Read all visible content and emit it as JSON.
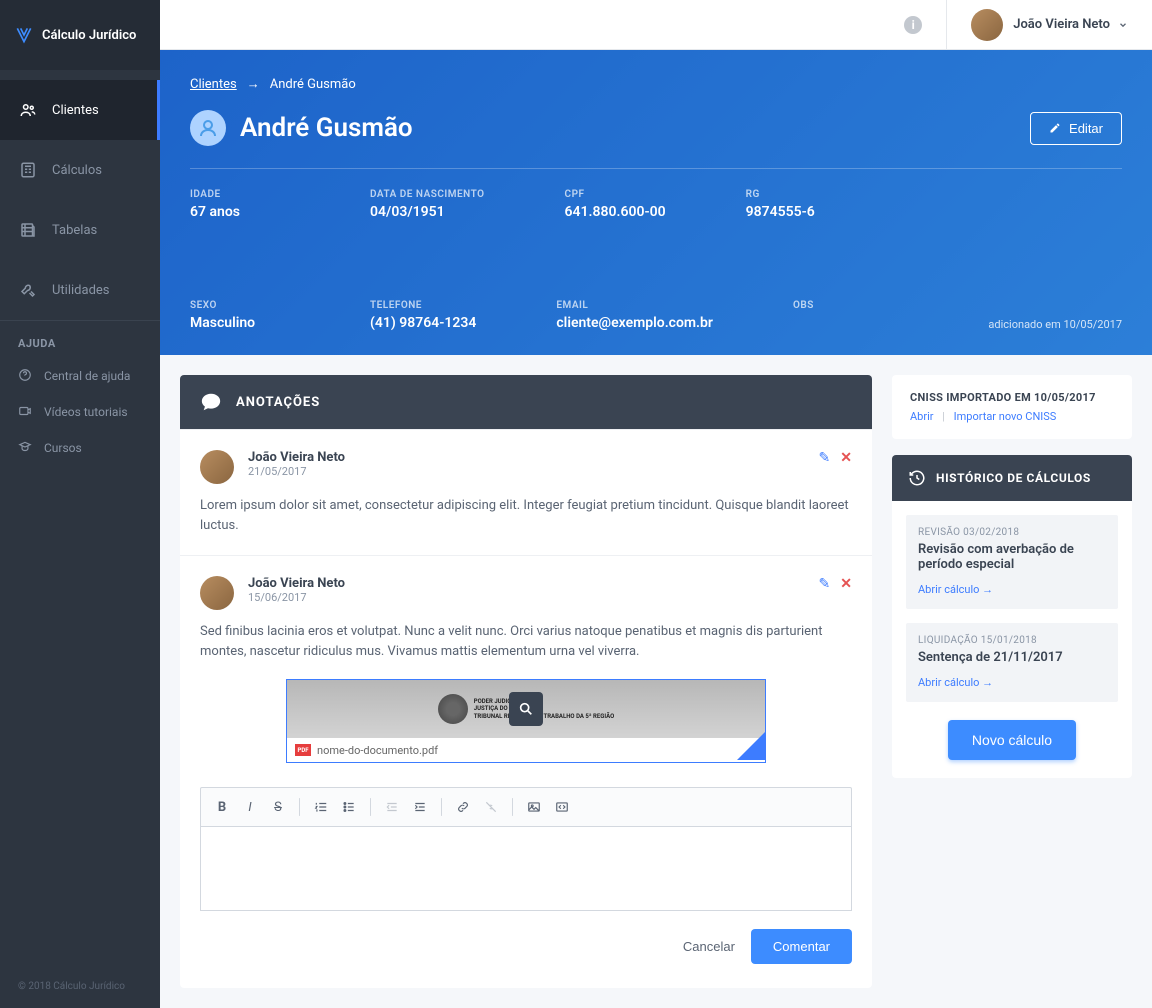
{
  "brand": {
    "name": "Cálculo Jurídico",
    "copyright": "© 2018 Cálculo Jurídico"
  },
  "sidebar": {
    "nav": [
      {
        "label": "Clientes",
        "icon": "clients-icon",
        "active": true
      },
      {
        "label": "Cálculos",
        "icon": "calc-icon",
        "active": false
      },
      {
        "label": "Tabelas",
        "icon": "tables-icon",
        "active": false
      },
      {
        "label": "Utilidades",
        "icon": "utils-icon",
        "active": false
      }
    ],
    "help_title": "AJUDA",
    "help": [
      {
        "label": "Central de ajuda",
        "icon": "help-icon"
      },
      {
        "label": "Vídeos tutoriais",
        "icon": "video-icon"
      },
      {
        "label": "Cursos",
        "icon": "courses-icon"
      }
    ]
  },
  "topbar": {
    "user_name": "João Vieira Neto"
  },
  "breadcrumb": {
    "root": "Clientes",
    "current": "André Gusmão"
  },
  "client": {
    "name": "André Gusmão",
    "edit_label": "Editar",
    "fields": {
      "idade": {
        "label": "IDADE",
        "value": "67 anos"
      },
      "nascimento": {
        "label": "DATA DE NASCIMENTO",
        "value": "04/03/1951"
      },
      "cpf": {
        "label": "CPF",
        "value": "641.880.600-00"
      },
      "rg": {
        "label": "RG",
        "value": "9874555-6"
      },
      "sexo": {
        "label": "SEXO",
        "value": "Masculino"
      },
      "telefone": {
        "label": "TELEFONE",
        "value": "(41) 98764-1234"
      },
      "email": {
        "label": "EMAIL",
        "value": "cliente@exemplo.com.br"
      },
      "obs": {
        "label": "OBS",
        "value": ""
      }
    },
    "added_on": "adicionado em 10/05/2017"
  },
  "notes": {
    "title": "ANOTAÇÕES",
    "items": [
      {
        "author": "João Vieira Neto",
        "date": "21/05/2017",
        "body": "Lorem ipsum dolor sit amet, consectetur adipiscing elit. Integer feugiat pretium tincidunt. Quisque blandit laoreet luctus."
      },
      {
        "author": "João Vieira Neto",
        "date": "15/06/2017",
        "body": "Sed finibus lacinia eros et volutpat. Nunc a velit nunc. Orci varius natoque penatibus et magnis dis parturient montes, nascetur ridiculus mus. Vivamus mattis elementum urna vel viverra."
      }
    ],
    "attachment": {
      "filename": "nome-do-documento.pdf",
      "preview_text": "PODER JUDICIÁRIO\nJUSTIÇA DO TRABALHO\nTRIBUNAL REGIONAL DO TRABALHO DA 5ª REGIÃO"
    },
    "editor": {
      "cancel": "Cancelar",
      "submit": "Comentar"
    }
  },
  "cniss": {
    "title": "CNISS IMPORTADO EM 10/05/2017",
    "open": "Abrir",
    "import": "Importar novo CNISS"
  },
  "history": {
    "title": "HISTÓRICO DE CÁLCULOS",
    "items": [
      {
        "meta": "REVISÃO 03/02/2018",
        "title": "Revisão com averbação de período especial",
        "link": "Abrir cálculo →"
      },
      {
        "meta": "LIQUIDAÇÃO 15/01/2018",
        "title": "Sentença de 21/11/2017",
        "link": "Abrir cálculo →"
      }
    ],
    "new_label": "Novo cálculo"
  }
}
